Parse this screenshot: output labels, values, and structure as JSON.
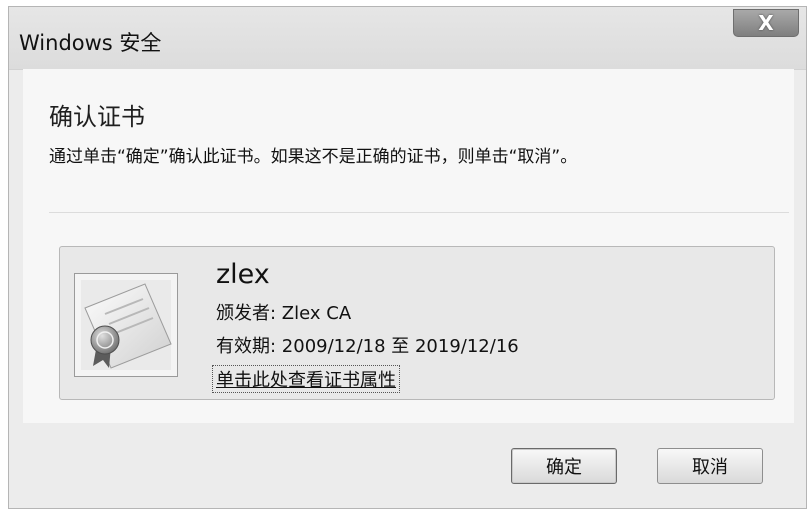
{
  "window": {
    "title": "Windows 安全",
    "close_label": "X"
  },
  "dialog": {
    "heading": "确认证书",
    "description": "通过单击“确定”确认此证书。如果这不是正确的证书，则单击“取消”。"
  },
  "certificate": {
    "name": "zlex",
    "issuer_label": "颁发者: Zlex CA",
    "validity_label": "有效期: 2009/12/18 至 2019/12/16",
    "properties_link": "单击此处查看证书属性"
  },
  "buttons": {
    "ok_label": "确定",
    "cancel_label": "取消"
  }
}
